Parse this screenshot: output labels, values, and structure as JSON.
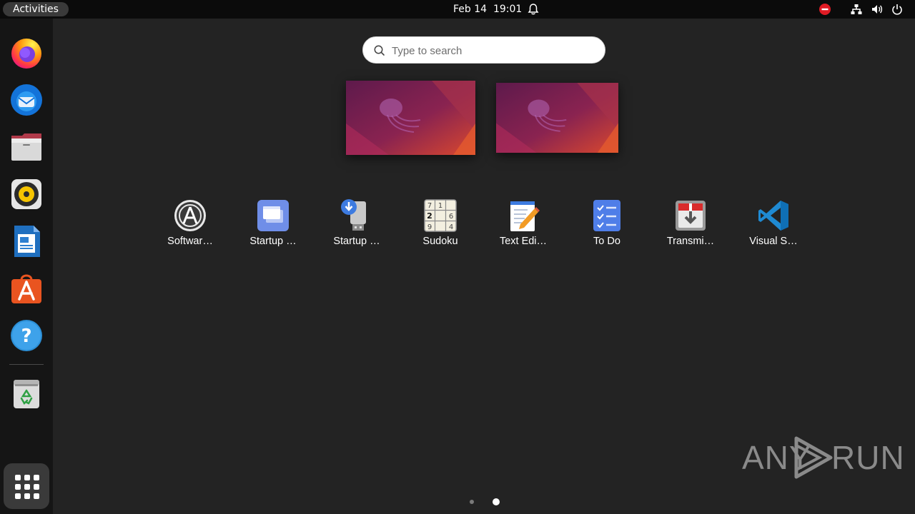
{
  "topbar": {
    "activities_label": "Activities",
    "date": "Feb 14",
    "time": "19:01"
  },
  "dock": {
    "apps": [
      {
        "name": "Firefox",
        "icon": "firefox-icon"
      },
      {
        "name": "Thunderbird",
        "icon": "thunderbird-icon"
      },
      {
        "name": "Files",
        "icon": "files-icon"
      },
      {
        "name": "Rhythmbox",
        "icon": "rhythmbox-icon"
      },
      {
        "name": "LibreOffice Writer",
        "icon": "writer-icon"
      },
      {
        "name": "Ubuntu Software",
        "icon": "ubuntu-software-icon"
      },
      {
        "name": "Help",
        "icon": "help-icon"
      },
      {
        "name": "Trash",
        "icon": "trash-icon"
      }
    ],
    "show_apps_icon": "app-grid-icon"
  },
  "search": {
    "placeholder": "Type to search",
    "value": ""
  },
  "workspaces": [
    {
      "index": 1,
      "wallpaper": "ubuntu-jellyfish"
    },
    {
      "index": 2,
      "wallpaper": "ubuntu-jellyfish"
    }
  ],
  "app_grid": [
    {
      "label": "Softwar…",
      "icon": "software-updater-icon"
    },
    {
      "label": "Startup …",
      "icon": "startup-applications-icon"
    },
    {
      "label": "Startup …",
      "icon": "startup-disk-creator-icon"
    },
    {
      "label": "Sudoku",
      "icon": "sudoku-icon"
    },
    {
      "label": "Text Edi…",
      "icon": "text-editor-icon"
    },
    {
      "label": "To Do",
      "icon": "todo-icon"
    },
    {
      "label": "Transmi…",
      "icon": "transmission-icon"
    },
    {
      "label": "Visual S…",
      "icon": "vscode-icon"
    }
  ],
  "pagination": {
    "pages": 2,
    "current": 2
  },
  "watermark": {
    "left": "ANY",
    "right": "RUN"
  },
  "colors": {
    "ubuntu_orange": "#E95420",
    "panel": "#0B0B0B",
    "dock": "#151515",
    "background": "#232323"
  }
}
